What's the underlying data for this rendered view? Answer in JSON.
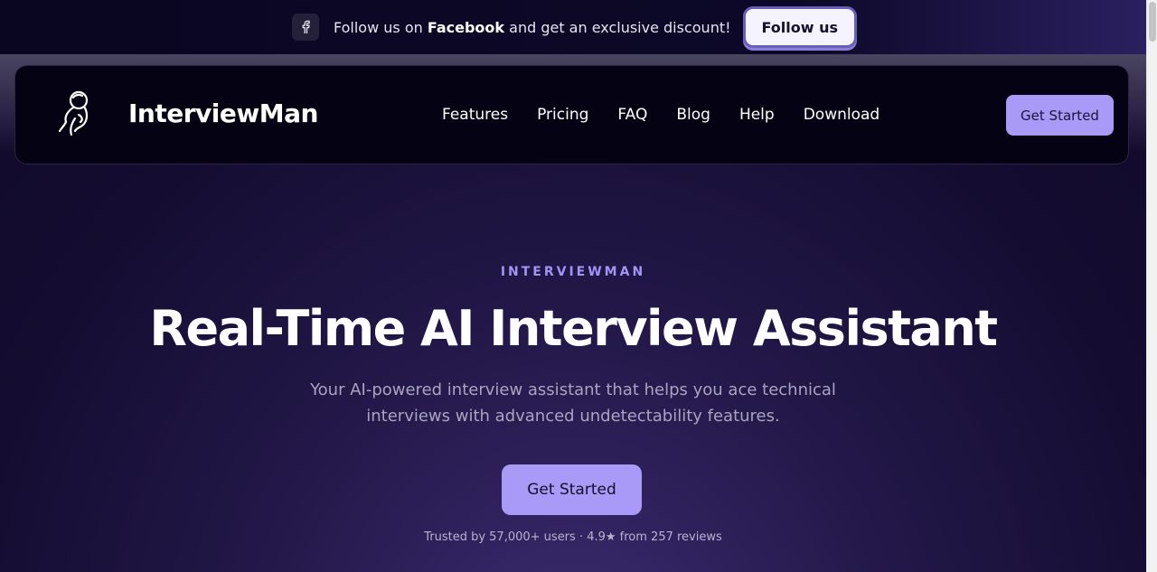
{
  "promo": {
    "icon": "facebook-icon",
    "text_before": "Follow us on ",
    "text_bold": "Facebook",
    "text_after": " and get an exclusive discount!",
    "button_label": "Follow us"
  },
  "navbar": {
    "logo_icon": "astronaut-icon",
    "brand": "InterviewMan",
    "links": [
      {
        "label": "Features"
      },
      {
        "label": "Pricing"
      },
      {
        "label": "FAQ"
      },
      {
        "label": "Blog"
      },
      {
        "label": "Help"
      },
      {
        "label": "Download"
      }
    ],
    "cta_label": "Get Started"
  },
  "hero": {
    "eyebrow": "INTERVIEWMAN",
    "title": "Real-Time AI Interview Assistant",
    "subtitle": "Your AI-powered interview assistant that helps you ace technical interviews with advanced undetectability features.",
    "cta_label": "Get Started",
    "trust_text": "Trusted by 57,000+ users · 4.9★ from 257 reviews"
  },
  "colors": {
    "accent": "#a99af8",
    "eyebrow": "#a493f5",
    "background": "#120b2a",
    "navbar_bg": "#050313"
  }
}
